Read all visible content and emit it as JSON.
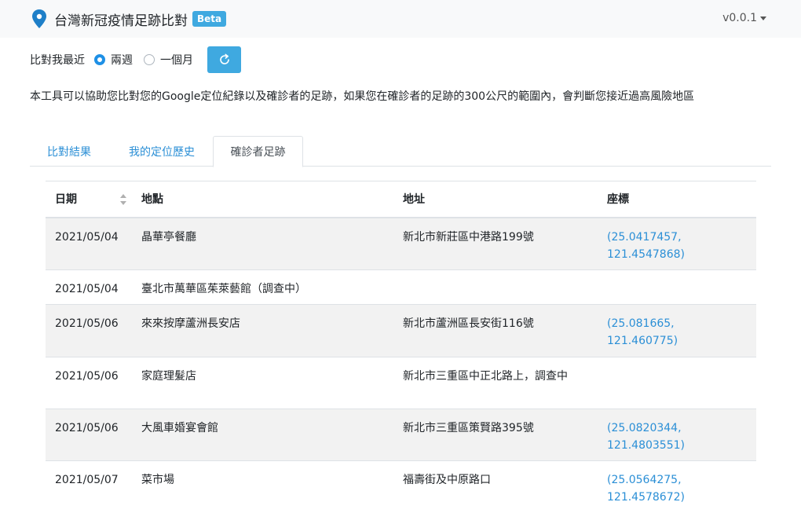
{
  "header": {
    "title": "台灣新冠疫情足跡比對",
    "badge": "Beta",
    "version": "v0.0.1"
  },
  "compare": {
    "label": "比對我最近",
    "options": [
      {
        "label": "兩週",
        "checked": true
      },
      {
        "label": "一個月",
        "checked": false
      }
    ]
  },
  "description": "本工具可以協助您比對您的Google定位紀錄以及確診者的足跡，如果您在確診者的足跡的300公尺的範圍內，會判斷您接近過高風險地區",
  "tabs": [
    {
      "label": "比對結果",
      "active": false
    },
    {
      "label": "我的定位歷史",
      "active": false
    },
    {
      "label": "確診者足跡",
      "active": true
    }
  ],
  "table": {
    "columns": [
      "日期",
      "地點",
      "地址",
      "座標"
    ],
    "rows": [
      {
        "date": "2021/05/04",
        "place": "晶華亭餐廳",
        "address": "新北市新莊區中港路199號",
        "coord": "(25.0417457, 121.4547868)"
      },
      {
        "date": "2021/05/04",
        "place": "臺北市萬華區茱萊藝館（調查中）",
        "address": "",
        "coord": ""
      },
      {
        "date": "2021/05/06",
        "place": "來來按摩蘆洲長安店",
        "address": "新北市蘆洲區長安街116號",
        "coord": "(25.081665, 121.460775)"
      },
      {
        "date": "2021/05/06",
        "place": "家庭理髮店",
        "address": "新北市三重區中正北路上，調查中",
        "coord": ""
      },
      {
        "date": "2021/05/06",
        "place": "大風車婚宴會館",
        "address": "新北市三重區策賢路395號",
        "coord": "(25.0820344, 121.4803551)"
      },
      {
        "date": "2021/05/07",
        "place": "菜市場",
        "address": "福壽街及中原路口",
        "coord": "(25.0564275, 121.4578672)"
      }
    ]
  },
  "colors": {
    "accent": "#3fa9e0",
    "link": "#2b8fd6"
  }
}
